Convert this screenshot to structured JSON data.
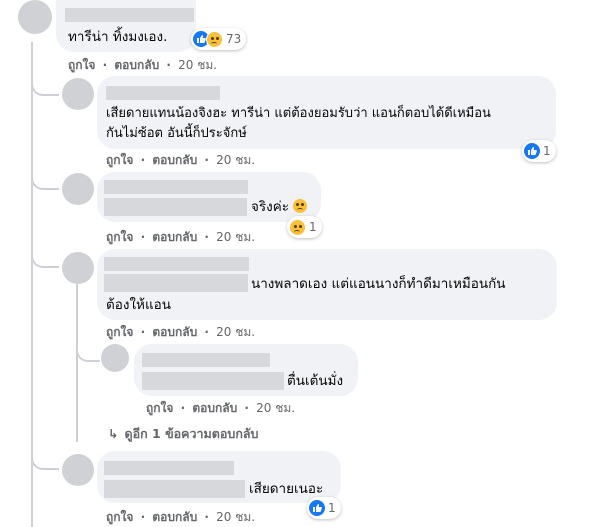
{
  "actions": {
    "like": "ถูกใจ",
    "reply": "ตอบกลับ",
    "sep": "·"
  },
  "comments": [
    {
      "text": "ทารีน่า ทิ้งมงเอง.",
      "time": "20 ชม.",
      "reactions": {
        "count": "73",
        "types": [
          "like-icon",
          "sad-face-icon"
        ]
      }
    },
    {
      "text_line1": "เสียดายแทนน้องจิงฮะ ทารีน่า แต่ต้องยอมรับว่า แอนก็ตอบได้ดีเหมือน",
      "text_line2": "กันไม่ซ้อต อันนี้ก็ประจักษ์",
      "time": "20 ชม.",
      "reactions": {
        "count": "1",
        "types": [
          "like-icon"
        ]
      }
    },
    {
      "text": "จริงค่ะ",
      "time": "20 ชม.",
      "reactions": {
        "count": "1",
        "types": [
          "sad-face-icon"
        ]
      }
    },
    {
      "text_line1": "นางพลาดเอง แต่แอนนางก็ทำดีมาเหมือนกัน",
      "text_line2": "ต้องให้แอน",
      "time": "20 ชม."
    },
    {
      "text": "ตื่นเต้นมั่ง",
      "time": "20 ชม."
    },
    {
      "text": "เสียดายเนอะ",
      "time": "20 ชม.",
      "reactions": {
        "count": "1",
        "types": [
          "like-icon"
        ]
      }
    }
  ],
  "more_replies": "ดูอีก 1 ข้อความตอบกลับ"
}
